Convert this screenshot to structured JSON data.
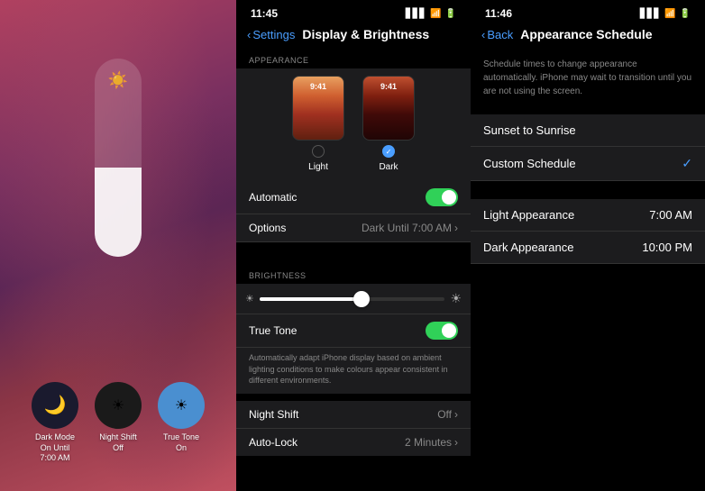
{
  "panel1": {
    "buttons": [
      {
        "id": "dark-mode",
        "label": "Dark Mode\nOn Until\n7:00 AM",
        "icon": "🌙",
        "color": "dark"
      },
      {
        "id": "night-shift",
        "label": "Night Shift\nOff",
        "icon": "☀",
        "color": "night"
      },
      {
        "id": "true-tone",
        "label": "True Tone\nOn",
        "icon": "☀",
        "color": "truetone"
      }
    ]
  },
  "panel2": {
    "status_time": "11:45",
    "nav_back_label": "Settings",
    "nav_title": "Display & Brightness",
    "section_appearance": "APPEARANCE",
    "light_label": "Light",
    "dark_label": "Dark",
    "automatic_label": "Automatic",
    "options_label": "Options",
    "options_value": "Dark Until 7:00 AM",
    "section_brightness": "BRIGHTNESS",
    "true_tone_label": "True Tone",
    "true_tone_desc": "Automatically adapt iPhone display based on ambient lighting conditions to make colours appear consistent in different environments.",
    "night_shift_label": "Night Shift",
    "night_shift_value": "Off",
    "auto_lock_label": "Auto-Lock",
    "auto_lock_value": "2 Minutes",
    "preview_time": "9:41"
  },
  "panel3": {
    "status_time": "11:46",
    "nav_back_label": "Back",
    "nav_title": "Appearance Schedule",
    "description": "Schedule times to change appearance automatically. iPhone may wait to transition until you are not using the screen.",
    "option1": "Sunset to Sunrise",
    "option2": "Custom Schedule",
    "light_appearance_label": "Light Appearance",
    "light_appearance_time": "7:00 AM",
    "dark_appearance_label": "Dark Appearance",
    "dark_appearance_time": "10:00 PM"
  }
}
